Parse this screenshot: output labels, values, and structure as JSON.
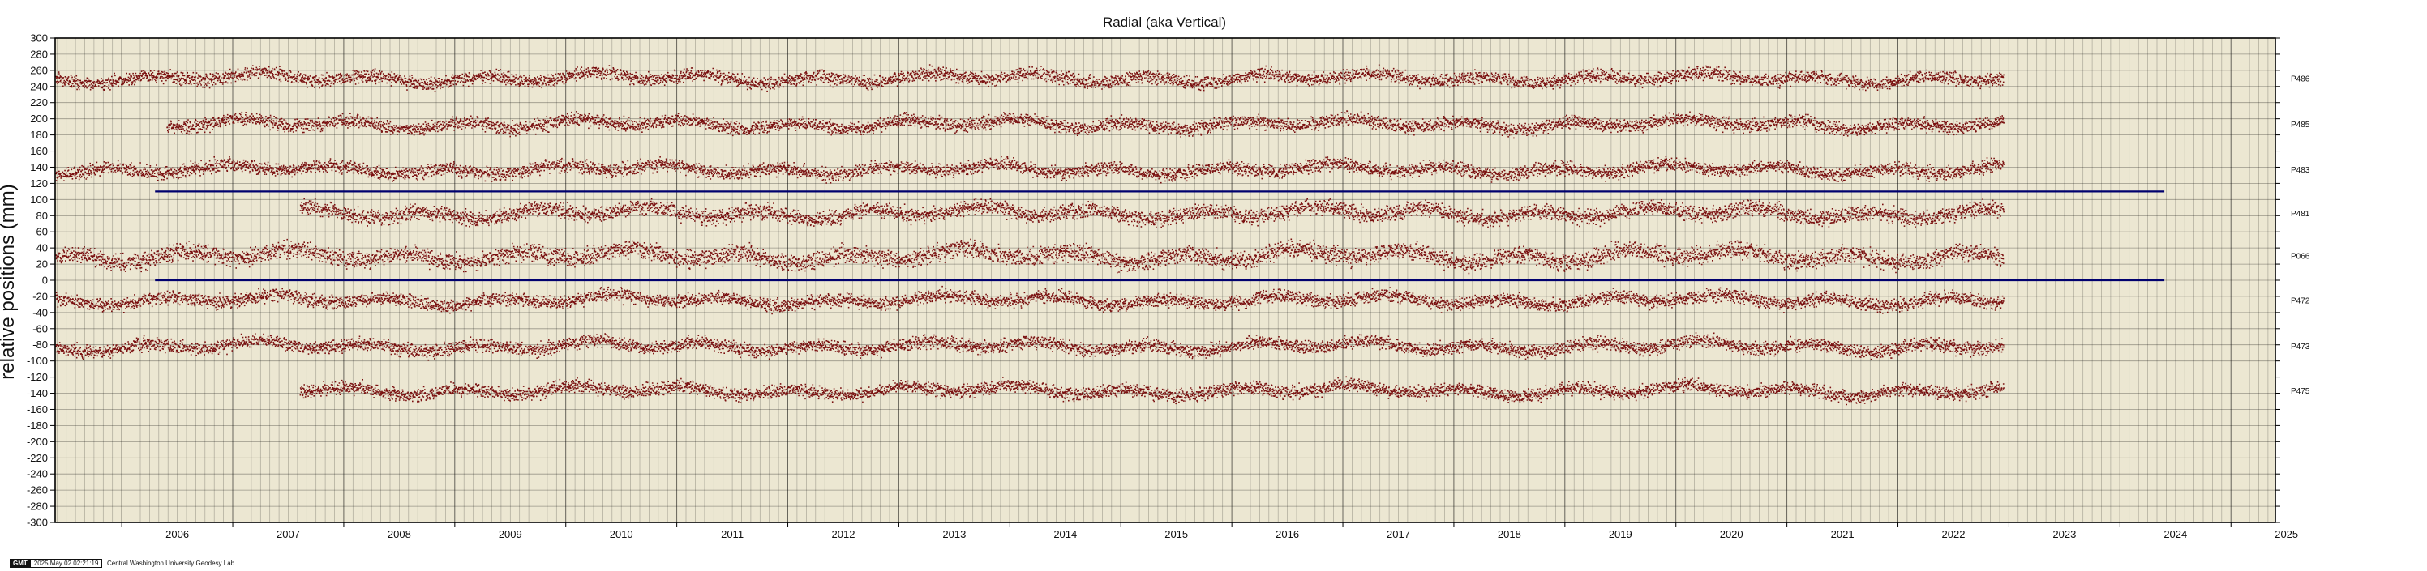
{
  "footer": {
    "logo": "GMT",
    "timestamp": "2025 May 02 02:21:19",
    "credit": "Central Washington University Geodesy Lab"
  },
  "chart_data": {
    "type": "scatter",
    "title": "Radial (aka Vertical)",
    "ylabel": "relative positions (mm)",
    "xlabel": "",
    "xlim": [
      2005.4,
      2025.4
    ],
    "ylim": [
      -300,
      300
    ],
    "y_ticks": [
      300,
      280,
      260,
      240,
      220,
      200,
      180,
      160,
      140,
      120,
      100,
      80,
      60,
      40,
      20,
      0,
      -20,
      -40,
      -60,
      -80,
      -100,
      -120,
      -140,
      -160,
      -180,
      -200,
      -220,
      -240,
      -260,
      -280,
      -300
    ],
    "x_ticks": [
      2006,
      2007,
      2008,
      2009,
      2010,
      2011,
      2012,
      2013,
      2014,
      2015,
      2016,
      2017,
      2018,
      2019,
      2020,
      2021,
      2022,
      2023,
      2024,
      2025
    ],
    "grid": true,
    "background": "#ece7d2",
    "point_color": "#7a1010",
    "reference_line_color": "#00006e",
    "reference_lines": [
      {
        "y": 110,
        "x_start": 2006.3,
        "x_end": 2024.4
      },
      {
        "y": 0,
        "x_start": 2006.3,
        "x_end": 2024.4
      }
    ],
    "series": [
      {
        "name": "P486",
        "offset": 250,
        "start": 2005.4,
        "end": 2022.95,
        "amplitude": 6
      },
      {
        "name": "P485",
        "offset": 193,
        "start": 2006.4,
        "end": 2022.95,
        "amplitude": 6
      },
      {
        "name": "P483",
        "offset": 137,
        "start": 2005.4,
        "end": 2022.95,
        "amplitude": 6
      },
      {
        "name": "P481",
        "offset": 83,
        "start": 2007.6,
        "end": 2022.95,
        "amplitude": 7
      },
      {
        "name": "P066",
        "offset": 30,
        "start": 2005.4,
        "end": 2022.95,
        "amplitude": 8
      },
      {
        "name": "P472",
        "offset": -25,
        "start": 2005.4,
        "end": 2022.95,
        "amplitude": 6
      },
      {
        "name": "P473",
        "offset": -82,
        "start": 2005.4,
        "end": 2022.95,
        "amplitude": 6
      },
      {
        "name": "P475",
        "offset": -137,
        "start": 2007.6,
        "end": 2022.95,
        "amplitude": 6
      }
    ]
  }
}
